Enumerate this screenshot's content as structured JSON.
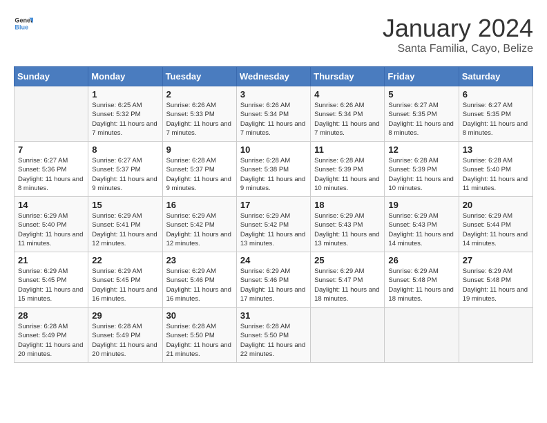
{
  "logo": {
    "general": "General",
    "blue": "Blue"
  },
  "title": "January 2024",
  "subtitle": "Santa Familia, Cayo, Belize",
  "days_of_week": [
    "Sunday",
    "Monday",
    "Tuesday",
    "Wednesday",
    "Thursday",
    "Friday",
    "Saturday"
  ],
  "weeks": [
    [
      {
        "day": "",
        "empty": true
      },
      {
        "day": "1",
        "sunrise": "6:25 AM",
        "sunset": "5:32 PM",
        "daylight": "11 hours and 7 minutes."
      },
      {
        "day": "2",
        "sunrise": "6:26 AM",
        "sunset": "5:33 PM",
        "daylight": "11 hours and 7 minutes."
      },
      {
        "day": "3",
        "sunrise": "6:26 AM",
        "sunset": "5:34 PM",
        "daylight": "11 hours and 7 minutes."
      },
      {
        "day": "4",
        "sunrise": "6:26 AM",
        "sunset": "5:34 PM",
        "daylight": "11 hours and 7 minutes."
      },
      {
        "day": "5",
        "sunrise": "6:27 AM",
        "sunset": "5:35 PM",
        "daylight": "11 hours and 8 minutes."
      },
      {
        "day": "6",
        "sunrise": "6:27 AM",
        "sunset": "5:35 PM",
        "daylight": "11 hours and 8 minutes."
      }
    ],
    [
      {
        "day": "7",
        "sunrise": "6:27 AM",
        "sunset": "5:36 PM",
        "daylight": "11 hours and 8 minutes."
      },
      {
        "day": "8",
        "sunrise": "6:27 AM",
        "sunset": "5:37 PM",
        "daylight": "11 hours and 9 minutes."
      },
      {
        "day": "9",
        "sunrise": "6:28 AM",
        "sunset": "5:37 PM",
        "daylight": "11 hours and 9 minutes."
      },
      {
        "day": "10",
        "sunrise": "6:28 AM",
        "sunset": "5:38 PM",
        "daylight": "11 hours and 9 minutes."
      },
      {
        "day": "11",
        "sunrise": "6:28 AM",
        "sunset": "5:39 PM",
        "daylight": "11 hours and 10 minutes."
      },
      {
        "day": "12",
        "sunrise": "6:28 AM",
        "sunset": "5:39 PM",
        "daylight": "11 hours and 10 minutes."
      },
      {
        "day": "13",
        "sunrise": "6:28 AM",
        "sunset": "5:40 PM",
        "daylight": "11 hours and 11 minutes."
      }
    ],
    [
      {
        "day": "14",
        "sunrise": "6:29 AM",
        "sunset": "5:40 PM",
        "daylight": "11 hours and 11 minutes."
      },
      {
        "day": "15",
        "sunrise": "6:29 AM",
        "sunset": "5:41 PM",
        "daylight": "11 hours and 12 minutes."
      },
      {
        "day": "16",
        "sunrise": "6:29 AM",
        "sunset": "5:42 PM",
        "daylight": "11 hours and 12 minutes."
      },
      {
        "day": "17",
        "sunrise": "6:29 AM",
        "sunset": "5:42 PM",
        "daylight": "11 hours and 13 minutes."
      },
      {
        "day": "18",
        "sunrise": "6:29 AM",
        "sunset": "5:43 PM",
        "daylight": "11 hours and 13 minutes."
      },
      {
        "day": "19",
        "sunrise": "6:29 AM",
        "sunset": "5:43 PM",
        "daylight": "11 hours and 14 minutes."
      },
      {
        "day": "20",
        "sunrise": "6:29 AM",
        "sunset": "5:44 PM",
        "daylight": "11 hours and 14 minutes."
      }
    ],
    [
      {
        "day": "21",
        "sunrise": "6:29 AM",
        "sunset": "5:45 PM",
        "daylight": "11 hours and 15 minutes."
      },
      {
        "day": "22",
        "sunrise": "6:29 AM",
        "sunset": "5:45 PM",
        "daylight": "11 hours and 16 minutes."
      },
      {
        "day": "23",
        "sunrise": "6:29 AM",
        "sunset": "5:46 PM",
        "daylight": "11 hours and 16 minutes."
      },
      {
        "day": "24",
        "sunrise": "6:29 AM",
        "sunset": "5:46 PM",
        "daylight": "11 hours and 17 minutes."
      },
      {
        "day": "25",
        "sunrise": "6:29 AM",
        "sunset": "5:47 PM",
        "daylight": "11 hours and 18 minutes."
      },
      {
        "day": "26",
        "sunrise": "6:29 AM",
        "sunset": "5:48 PM",
        "daylight": "11 hours and 18 minutes."
      },
      {
        "day": "27",
        "sunrise": "6:29 AM",
        "sunset": "5:48 PM",
        "daylight": "11 hours and 19 minutes."
      }
    ],
    [
      {
        "day": "28",
        "sunrise": "6:28 AM",
        "sunset": "5:49 PM",
        "daylight": "11 hours and 20 minutes."
      },
      {
        "day": "29",
        "sunrise": "6:28 AM",
        "sunset": "5:49 PM",
        "daylight": "11 hours and 20 minutes."
      },
      {
        "day": "30",
        "sunrise": "6:28 AM",
        "sunset": "5:50 PM",
        "daylight": "11 hours and 21 minutes."
      },
      {
        "day": "31",
        "sunrise": "6:28 AM",
        "sunset": "5:50 PM",
        "daylight": "11 hours and 22 minutes."
      },
      {
        "day": "",
        "empty": true
      },
      {
        "day": "",
        "empty": true
      },
      {
        "day": "",
        "empty": true
      }
    ]
  ]
}
